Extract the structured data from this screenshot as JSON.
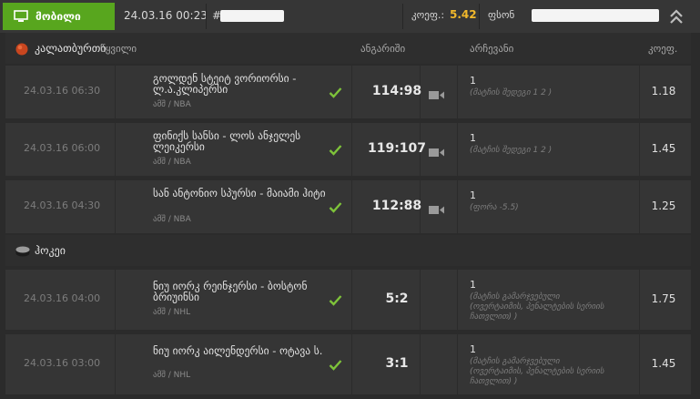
{
  "topbar": {
    "badge_label": "მობილი",
    "date": "24.03.16 00:23",
    "hash": "#",
    "coef_label": "კოეფ.:",
    "coef_value": "5.42",
    "fsn_label": "ფსონ"
  },
  "sections": [
    {
      "sport": "კალათბურთი",
      "columns": {
        "team": "წყვილი",
        "score": "ანგარიში",
        "outcome": "არჩევანი",
        "coef": "კოეფ."
      },
      "rows": [
        {
          "date": "24.03.16 06:30",
          "teams": "გოლდენ სტეიტ ვორიორსი - ლ.ა.კლიპერსი",
          "league": "ამშ / NBA",
          "score": "114:98",
          "outcome": "1",
          "detail": "(მატჩის შედეგი 1 2 )",
          "coef": "1.18"
        },
        {
          "date": "24.03.16 06:00",
          "teams": "ფინიქს სანსი - ლოს ანჯელეს ლეიკერსი",
          "league": "ამშ / NBA",
          "score": "119:107",
          "outcome": "1",
          "detail": "(მატჩის შედეგი 1 2 )",
          "coef": "1.45"
        },
        {
          "date": "24.03.16 04:30",
          "teams": "სან ანტონიო სპურსი - მაიამი ჰიტი",
          "league": "ამშ / NBA",
          "score": "112:88",
          "outcome": "1",
          "detail": "(ფორა -5.5)",
          "coef": "1.25"
        }
      ]
    },
    {
      "sport": "ჰოკეი",
      "rows": [
        {
          "date": "24.03.16 04:00",
          "teams": "ნიუ იორკ რეინჯერსი - ბოსტონ ბრიუინსი",
          "league": "ამშ / NHL",
          "score": "5:2",
          "outcome": "1",
          "detail": "(მატჩის გამარჯვებული (ოვერტაიმის, პენალტების სერიის ჩათვლით) )",
          "coef": "1.75"
        },
        {
          "date": "24.03.16 03:00",
          "teams": "ნიუ იორკ აილენდერსი - ოტავა ს.",
          "league": "ამშ / NHL",
          "score": "3:1",
          "outcome": "1",
          "detail": "(მატჩის გამარჯვებული (ოვერტაიმის, პენალტების სერიის ჩათვლით) )",
          "coef": "1.45"
        }
      ]
    }
  ],
  "colors": {
    "accent_green": "#58a61e",
    "coef_yellow": "#f1b82b",
    "check_green": "#7ec33a"
  },
  "icons": {
    "badge": "monitor-icon",
    "basketball": "basketball-icon",
    "hockey": "hockey-puck-icon",
    "check": "check-icon",
    "video": "video-camera-icon",
    "collapse": "double-chevron-up-icon"
  }
}
